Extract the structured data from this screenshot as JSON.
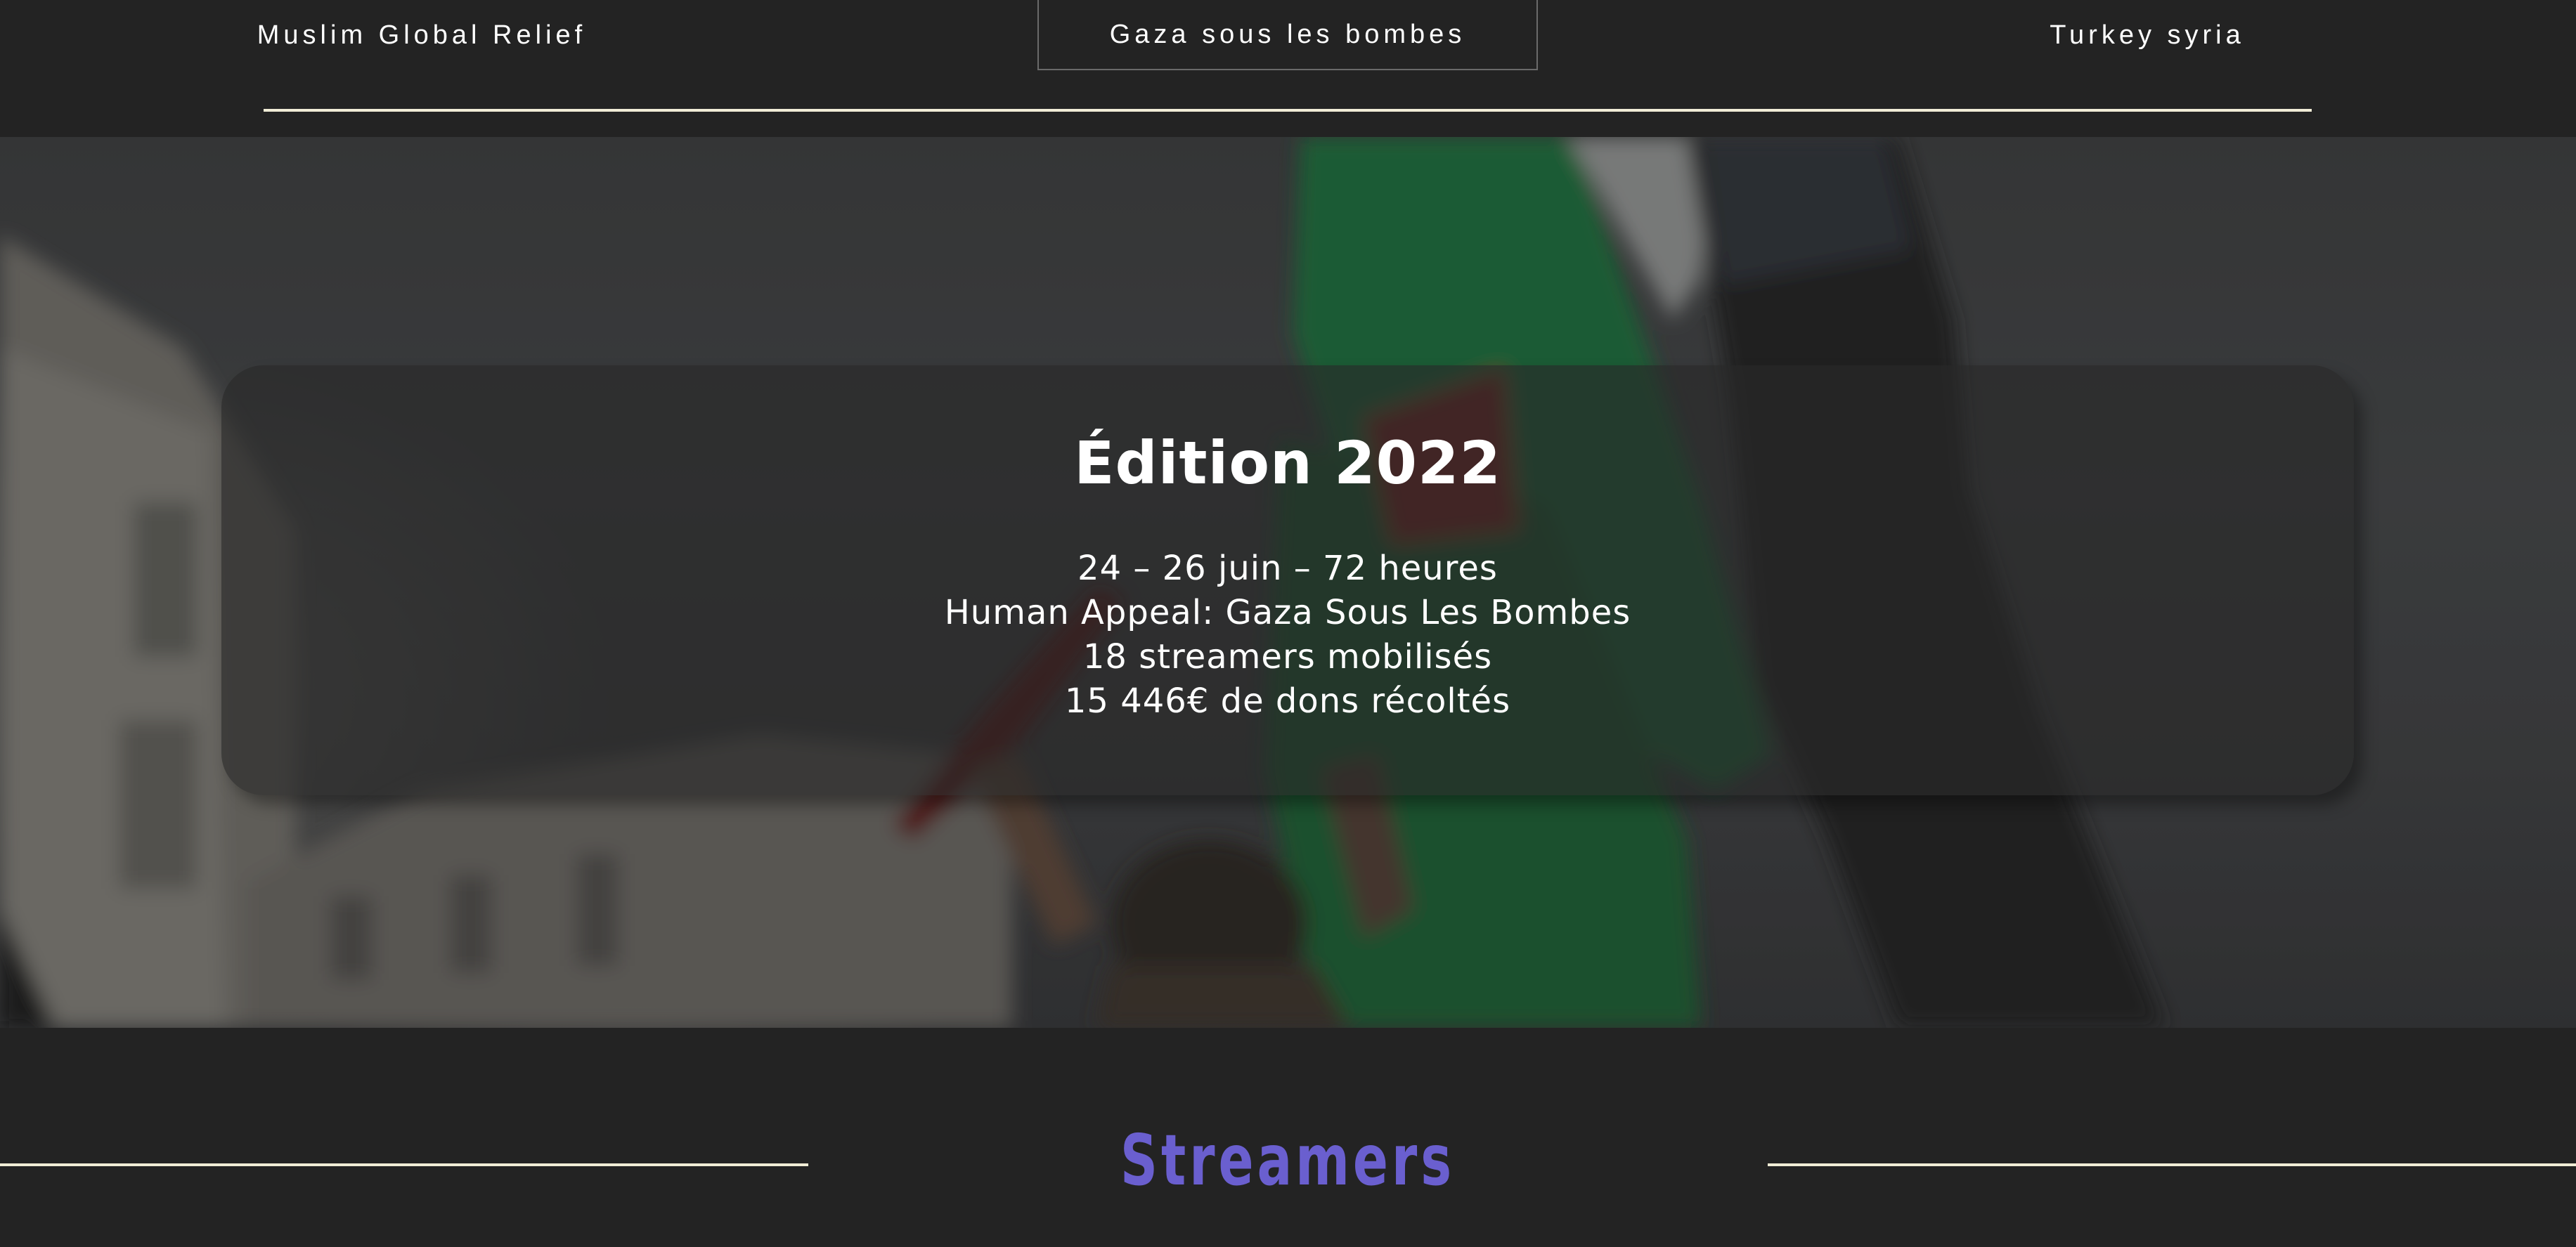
{
  "nav": {
    "left_label": "Muslim Global Relief",
    "center_label": "Gaza sous les bombes",
    "right_label": "Turkey syria"
  },
  "hero": {
    "title": "Édition 2022",
    "lines": [
      "24 – 26 juin – 72 heures",
      "Human Appeal: Gaza Sous Les Bombes",
      "18 streamers mobilisés",
      "15 446€ de dons récoltés"
    ],
    "background_subject": "protester-waving-palestinian-flag"
  },
  "streamers_section": {
    "title": "Streamers"
  },
  "colors": {
    "page_background": "#232323",
    "accent_title": "#6a5fcf",
    "rule": "#f0ecd6",
    "text": "#ffffff"
  }
}
